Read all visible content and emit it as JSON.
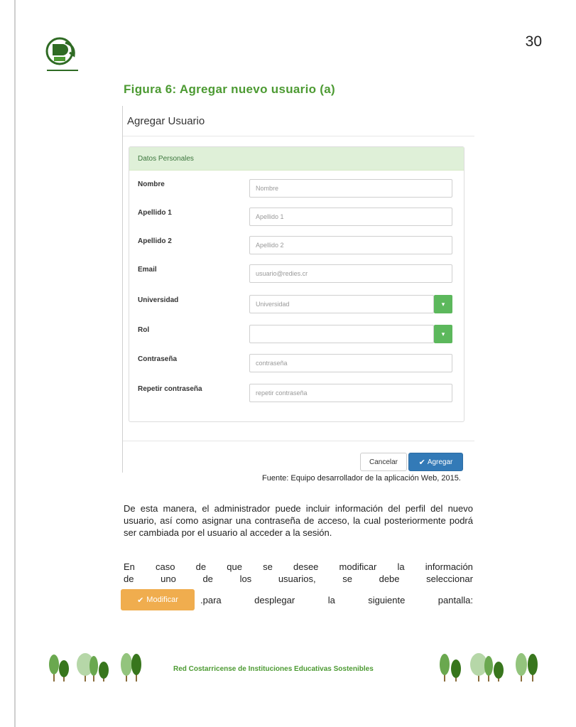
{
  "page": {
    "number": "30"
  },
  "figure": {
    "title": "Figura 6: Agregar nuevo usuario (a)",
    "source": "Fuente: Equipo desarrollador de la aplicación Web, 2015."
  },
  "form": {
    "heading": "Agregar Usuario",
    "section_title": "Datos Personales",
    "fields": [
      {
        "label": "Nombre",
        "placeholder": "Nombre",
        "type": "text"
      },
      {
        "label": "Apellido 1",
        "placeholder": "Apellido 1",
        "type": "text"
      },
      {
        "label": "Apellido 2",
        "placeholder": "Apellido 2",
        "type": "text"
      },
      {
        "label": "Email",
        "placeholder": "usuario@redies.cr",
        "type": "text"
      },
      {
        "label": "Universidad",
        "placeholder": "Universidad",
        "type": "select"
      },
      {
        "label": "Rol",
        "placeholder": "",
        "type": "select"
      },
      {
        "label": "Contraseña",
        "placeholder": "contraseña",
        "type": "text"
      },
      {
        "label": "Repetir contraseña",
        "placeholder": "repetir contraseña",
        "type": "text"
      }
    ],
    "cancel_label": "Cancelar",
    "add_label": "Agregar"
  },
  "body": {
    "paragraph1": "De esta manera, el administrador puede incluir información del perfil del nuevo usuario, así como asignar una contraseña de acceso, la cual posteriormente podrá ser cambiada por el usuario al acceder a la sesión.",
    "p2_line1": [
      "En",
      "caso",
      "de",
      "que",
      "se",
      "desee",
      "modificar",
      "la",
      "información"
    ],
    "p2_line2": [
      "de",
      "uno",
      "de",
      "los",
      "usuarios,",
      "se",
      "debe",
      "seleccionar"
    ],
    "p2_line3": [
      ".para",
      "desplegar",
      "la",
      "siguiente",
      "pantalla:"
    ],
    "modify_label": "Modificar"
  },
  "footer": {
    "organization": "Red Costarricense de Instituciones Educativas Sostenibles"
  },
  "colors": {
    "accent_green": "#4c9a32",
    "primary_blue": "#337ab7",
    "warning_orange": "#f0ad4e",
    "success_green": "#5cb85c"
  },
  "icons": [
    "redies-logo",
    "check-icon",
    "caret-down-icon",
    "tree-decoration"
  ]
}
